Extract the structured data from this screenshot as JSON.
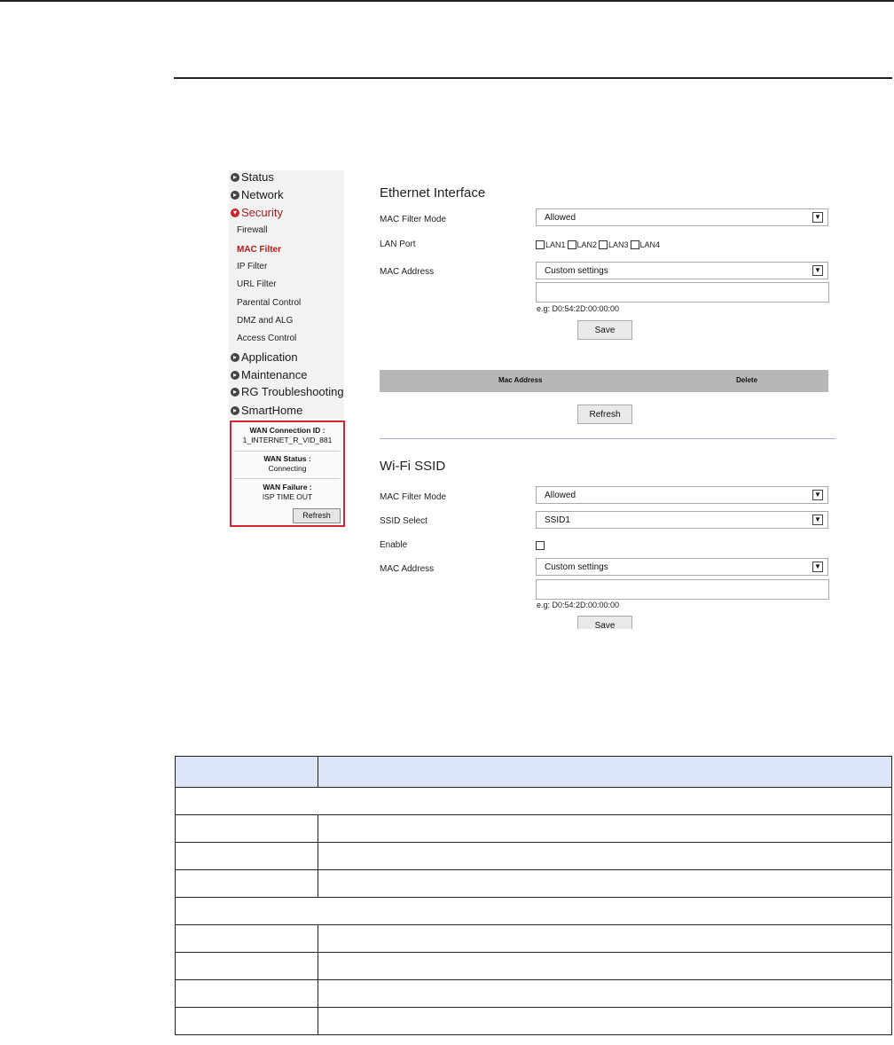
{
  "sidebar": {
    "menu": [
      {
        "label": "Status",
        "icon": "arrow-right-icon"
      },
      {
        "label": "Network",
        "icon": "arrow-right-icon"
      },
      {
        "label": "Security",
        "icon": "arrow-down-icon",
        "active": true
      }
    ],
    "security_items": [
      "Firewall",
      "MAC Filter",
      "IP Filter",
      "URL Filter",
      "Parental Control",
      "DMZ and ALG",
      "Access Control"
    ],
    "menu_bottom": [
      {
        "label": "Application",
        "icon": "arrow-right-icon"
      },
      {
        "label": "Maintenance",
        "icon": "arrow-right-icon"
      },
      {
        "label": "RG Troubleshooting",
        "icon": "arrow-right-icon"
      },
      {
        "label": "SmartHome",
        "icon": "arrow-right-icon"
      }
    ],
    "wan": {
      "connection_id_title": "WAN Connection ID :",
      "connection_id": "1_INTERNET_R_VID_881",
      "status_title": "WAN Status :",
      "status": "Connecting",
      "failure_title": "WAN Failure :",
      "failure": "ISP TIME OUT",
      "refresh_label": "Refresh"
    }
  },
  "ethernet": {
    "title": "Ethernet Interface",
    "mac_filter_mode_label": "MAC Filter Mode",
    "mac_filter_mode_value": "Allowed",
    "lan_port_label": "LAN Port",
    "lan_ports": [
      "LAN1",
      "LAN2",
      "LAN3",
      "LAN4"
    ],
    "mac_address_label": "MAC Address",
    "mac_address_value": "Custom settings",
    "mac_hint": "e.g: D0:54:2D:00:00:00",
    "save_label": "Save",
    "table_headers": [
      "Mac Address",
      "Delete"
    ],
    "refresh_label": "Refresh"
  },
  "wifi": {
    "title": "Wi-Fi SSID",
    "mac_filter_mode_label": "MAC Filter Mode",
    "mac_filter_mode_value": "Allowed",
    "ssid_select_label": "SSID Select",
    "ssid_select_value": "SSID1",
    "enable_label": "Enable",
    "mac_address_label": "MAC Address",
    "mac_address_value": "Custom settings",
    "mac_hint": "e.g: D0:54:2D:00:00:00",
    "save_label": "Save"
  },
  "colors": {
    "accent": "#c9242a",
    "table_header": "#dce4f7"
  }
}
